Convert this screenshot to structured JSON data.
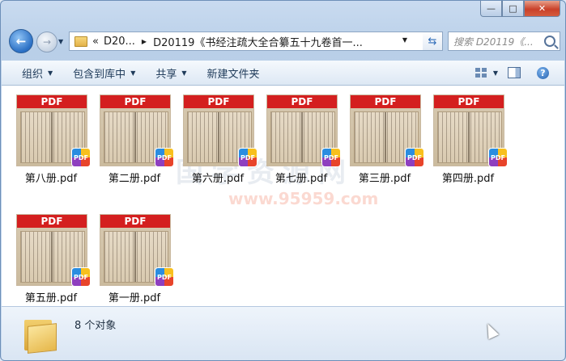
{
  "window": {
    "minimize_glyph": "—",
    "maximize_glyph": "□",
    "close_glyph": "✕"
  },
  "address": {
    "history_glyph": "«",
    "crumb_1": "D20...",
    "crumb_2": "D20119《书经注疏大全合纂五十九卷首一...",
    "search_placeholder": "搜索 D20119《..."
  },
  "toolbar": {
    "organize": "组织",
    "include_in_library": "包含到库中",
    "share": "共享",
    "new_folder": "新建文件夹",
    "help": "?"
  },
  "files": [
    {
      "name": "第八册.pdf",
      "thumb_label": "PDF"
    },
    {
      "name": "第二册.pdf",
      "thumb_label": "PDF"
    },
    {
      "name": "第六册.pdf",
      "thumb_label": "PDF"
    },
    {
      "name": "第七册.pdf",
      "thumb_label": "PDF"
    },
    {
      "name": "第三册.pdf",
      "thumb_label": "PDF"
    },
    {
      "name": "第四册.pdf",
      "thumb_label": "PDF"
    },
    {
      "name": "第五册.pdf",
      "thumb_label": "PDF"
    },
    {
      "name": "第一册.pdf",
      "thumb_label": "PDF"
    }
  ],
  "badge_label": "PDF",
  "watermark": {
    "text": "国学资源网",
    "url": "www.95959.com"
  },
  "status": {
    "count": "8 个对象"
  }
}
